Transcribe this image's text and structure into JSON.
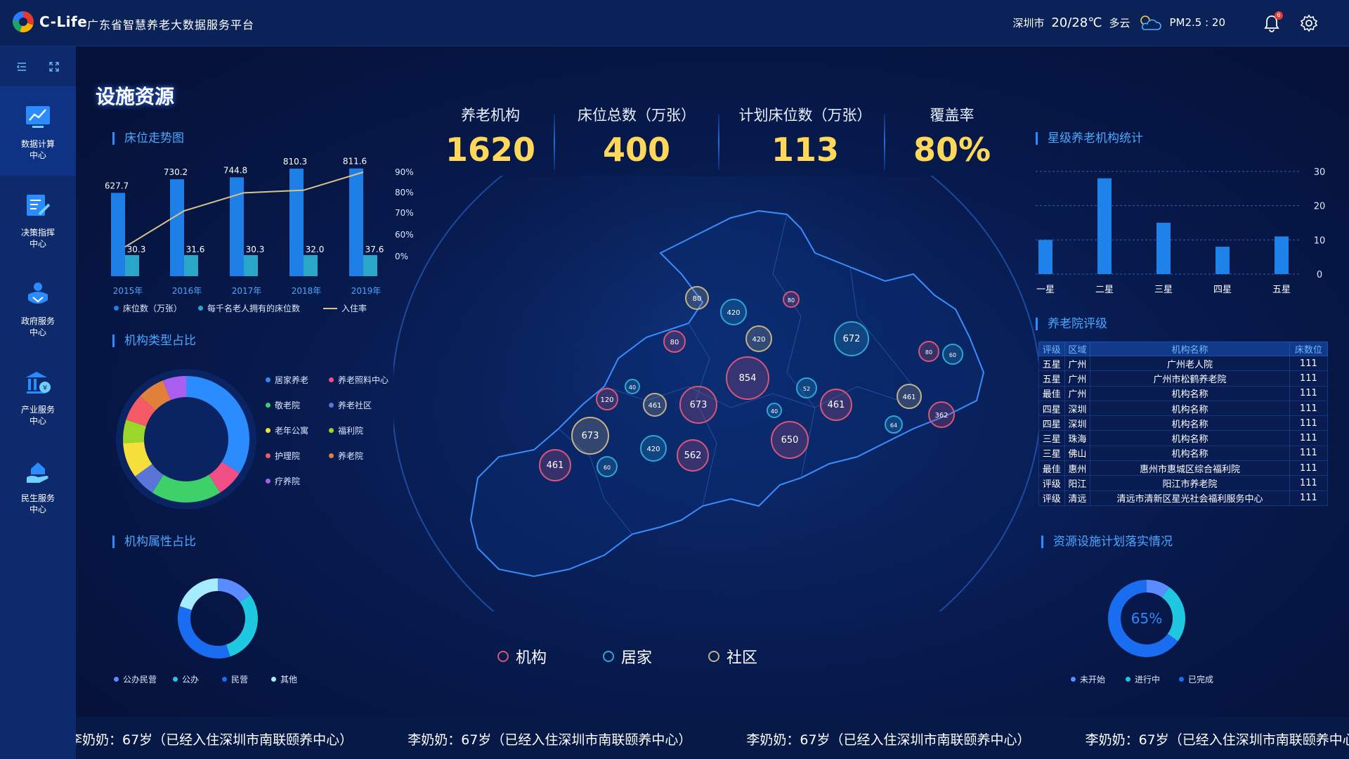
{
  "header": {
    "logo": "C-Life",
    "platform": "广东省智慧养老大数据服务平台",
    "city": "深圳市",
    "temperature": "20/28℃",
    "weather": "多云",
    "pm25": "PM2.5 : 20",
    "notification_count": "6"
  },
  "sidebar": {
    "items": [
      {
        "label1": "数据计算",
        "label2": "中心",
        "icon": "chart-analytics-icon"
      },
      {
        "label1": "决策指挥",
        "label2": "中心",
        "icon": "decision-icon"
      },
      {
        "label1": "政府服务",
        "label2": "中心",
        "icon": "government-icon"
      },
      {
        "label1": "产业服务",
        "label2": "中心",
        "icon": "industry-icon"
      },
      {
        "label1": "民生服务",
        "label2": "中心",
        "icon": "livelihood-icon"
      }
    ]
  },
  "page_title": "设施资源",
  "kpis": [
    {
      "label": "养老机构",
      "value": "1620"
    },
    {
      "label": "床位总数（万张）",
      "value": "400"
    },
    {
      "label": "计划床位数（万张）",
      "value": "113"
    },
    {
      "label": "覆盖率",
      "value": "80%"
    }
  ],
  "sections": {
    "bed_trend": "床位走势图",
    "org_type": "机构类型占比",
    "org_attr": "机构属性占比",
    "star_stats": "星级养老机构统计",
    "rating": "养老院评级",
    "plan": "资源设施计划落实情况"
  },
  "chart_data": [
    {
      "type": "bar",
      "categories": [
        "2015年",
        "2016年",
        "2017年",
        "2018年",
        "2019年"
      ],
      "series": [
        {
          "name": "床位数（万张）",
          "values": [
            627.7,
            730.2,
            744.8,
            810.3,
            811.6
          ]
        },
        {
          "name": "每千名老人拥有的床位数",
          "values": [
            30.3,
            31.6,
            30.3,
            32.0,
            37.6
          ]
        },
        {
          "name": "入住率",
          "values": [
            61,
            75,
            82,
            83,
            90
          ]
        }
      ],
      "y2_ticks": [
        "90%",
        "80%",
        "70%",
        "60%",
        "0%"
      ],
      "colors": [
        "#1e7fe6",
        "#2aa6c9",
        "#d7c48a"
      ]
    },
    {
      "type": "pie",
      "labels": [
        "居家养老",
        "养老照料中心",
        "敬老院",
        "养老社区",
        "老年公寓",
        "福利院",
        "护理院",
        "养老院",
        "疗养院"
      ],
      "values": [
        34,
        7,
        18,
        6,
        9,
        6,
        7,
        7,
        6
      ],
      "colors": [
        "#2a8cff",
        "#f04f86",
        "#3ed16a",
        "#5a74d8",
        "#f7df3b",
        "#9ad72a",
        "#f55a67",
        "#e0803a",
        "#a95ef0"
      ]
    },
    {
      "type": "pie",
      "labels": [
        "公办民营",
        "公办",
        "民营",
        "其他"
      ],
      "values": [
        15,
        30,
        35,
        20
      ],
      "colors": [
        "#5a8cff",
        "#1fc8e0",
        "#1a6cf0",
        "#a6ecff"
      ]
    },
    {
      "type": "bar",
      "categories": [
        "一星",
        "二星",
        "三星",
        "四星",
        "五星"
      ],
      "values": [
        10,
        28,
        15,
        8,
        11
      ],
      "ylim": [
        0,
        30
      ],
      "y_ticks": [
        "30",
        "20",
        "10",
        "0"
      ],
      "colors": [
        "#1f82ea"
      ]
    },
    {
      "type": "pie",
      "labels": [
        "未开始",
        "进行中",
        "已完成"
      ],
      "values": [
        10,
        25,
        65
      ],
      "center_label": "65%",
      "colors": [
        "#5a8cff",
        "#1fc8e0",
        "#1a6cf0"
      ]
    }
  ],
  "rating_table": {
    "headers": [
      "评级",
      "区域",
      "机构名称",
      "床数位"
    ],
    "rows": [
      [
        "五星",
        "广州",
        "广州老人院",
        "111"
      ],
      [
        "五星",
        "广州",
        "广州市松鹤养老院",
        "111"
      ],
      [
        "最佳",
        "广州",
        "机构名称",
        "111"
      ],
      [
        "四星",
        "深圳",
        "机构名称",
        "111"
      ],
      [
        "四星",
        "深圳",
        "机构名称",
        "111"
      ],
      [
        "三星",
        "珠海",
        "机构名称",
        "111"
      ],
      [
        "三星",
        "佛山",
        "机构名称",
        "111"
      ],
      [
        "最佳",
        "惠州",
        "惠州市惠城区综合福利院",
        "111"
      ],
      [
        "评级",
        "阳江",
        "阳江市养老院",
        "111"
      ],
      [
        "评级",
        "清远",
        "清远市清新区星光社会福利服务中心",
        "111"
      ]
    ]
  },
  "map": {
    "legend": [
      "机构",
      "居家",
      "社区"
    ],
    "legend_colors": [
      "#d8557a",
      "#2fa7d6",
      "#c2b28a"
    ],
    "bubbles": [
      {
        "v": "80",
        "t": 2
      },
      {
        "v": "420",
        "t": 1
      },
      {
        "v": "80",
        "t": 0
      },
      {
        "v": "80",
        "t": 0
      },
      {
        "v": "420",
        "t": 2
      },
      {
        "v": "672",
        "t": 1
      },
      {
        "v": "854",
        "t": 0
      },
      {
        "v": "80",
        "t": 0
      },
      {
        "v": "60",
        "t": 1
      },
      {
        "v": "40",
        "t": 1
      },
      {
        "v": "120",
        "t": 0
      },
      {
        "v": "461",
        "t": 2
      },
      {
        "v": "673",
        "t": 0
      },
      {
        "v": "52",
        "t": 1
      },
      {
        "v": "461",
        "t": 0
      },
      {
        "v": "461",
        "t": 2
      },
      {
        "v": "40",
        "t": 1
      },
      {
        "v": "362",
        "t": 0
      },
      {
        "v": "673",
        "t": 2
      },
      {
        "v": "64",
        "t": 1
      },
      {
        "v": "420",
        "t": 1
      },
      {
        "v": "562",
        "t": 0
      },
      {
        "v": "650",
        "t": 0
      },
      {
        "v": "461",
        "t": 0
      },
      {
        "v": "60",
        "t": 1
      }
    ]
  },
  "ticker": [
    "李奶奶：67岁（已经入住深圳市南联颐养中心）",
    "李奶奶：67岁（已经入住深圳市南联颐养中心）",
    "李奶奶：67岁（已经入住深圳市南联颐养中心）",
    "李奶奶：67岁（已经入住深圳市南联颐养中心）"
  ]
}
